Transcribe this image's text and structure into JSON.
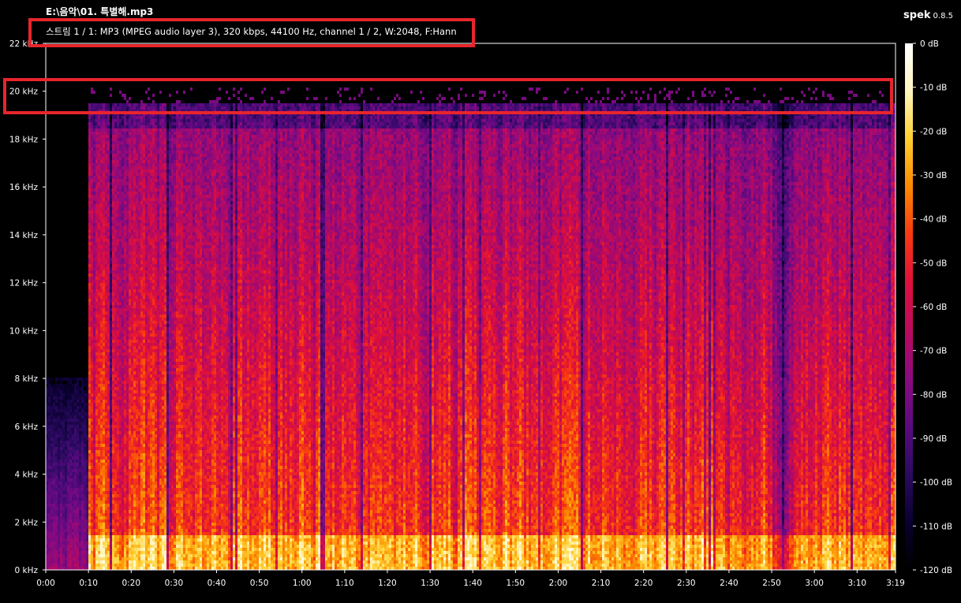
{
  "header": {
    "file_title": "E:\\음악\\01. 특별해.mp3",
    "stream_info": "스트림 1 / 1: MP3 (MPEG audio layer 3), 320 kbps, 44100 Hz, channel 1 / 2, W:2048, F:Hann",
    "brand": "spek",
    "version": "0.8.5"
  },
  "colors": {
    "background": "#000000",
    "highlight_box": "#e8252c",
    "axis_text": "#ffffff"
  },
  "chart_data": {
    "type": "heatmap",
    "title": "",
    "x_axis": {
      "unit": "mm:ss",
      "range_seconds": [
        0,
        199
      ],
      "tick_labels": [
        "0:00",
        "0:10",
        "0:20",
        "0:30",
        "0:40",
        "0:50",
        "1:00",
        "1:10",
        "1:20",
        "1:30",
        "1:40",
        "1:50",
        "2:00",
        "2:10",
        "2:20",
        "2:30",
        "2:40",
        "2:50",
        "3:00",
        "3:10",
        "3:19"
      ]
    },
    "y_axis": {
      "unit": "kHz",
      "range": [
        0,
        22
      ],
      "tick_labels": [
        "0 kHz",
        "2 kHz",
        "4 kHz",
        "6 kHz",
        "8 kHz",
        "10 kHz",
        "12 kHz",
        "14 kHz",
        "16 kHz",
        "18 kHz",
        "20 kHz",
        "22 kHz"
      ]
    },
    "colorbar": {
      "unit": "dB",
      "range": [
        -120,
        0
      ],
      "tick_labels": [
        "0 dB",
        "-10 dB",
        "-20 dB",
        "-30 dB",
        "-40 dB",
        "-50 dB",
        "-60 dB",
        "-70 dB",
        "-80 dB",
        "-90 dB",
        "-100 dB",
        "-110 dB",
        "-120 dB"
      ],
      "palette": [
        "#000000",
        "#0a0030",
        "#2a0a60",
        "#5a0a80",
        "#8a0a80",
        "#b80a60",
        "#e0103a",
        "#f83a10",
        "#fc8a00",
        "#ffd030",
        "#fff6c0",
        "#ffffff"
      ]
    },
    "observations": {
      "intro_silence_until_seconds": 10,
      "frequency_cutoff_khz": 19.5,
      "highlighted_frequency_khz": 20
    }
  }
}
